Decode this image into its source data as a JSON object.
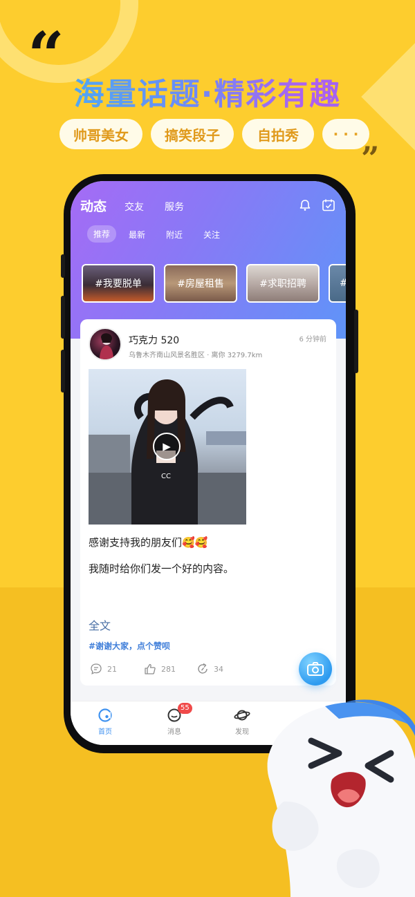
{
  "promo": {
    "headline": "海量话题·精彩有趣",
    "chips": [
      "帅哥美女",
      "搞笑段子",
      "自拍秀",
      "· · ·"
    ]
  },
  "app": {
    "nav_tabs": [
      "动态",
      "交友",
      "服务"
    ],
    "header_icons": [
      "bell-icon",
      "calendar-check-icon"
    ],
    "sub_tabs": [
      "推荐",
      "最新",
      "附近",
      "关注"
    ],
    "topics": [
      "#我要脱单",
      "#房屋租售",
      "#求职招聘",
      "#"
    ],
    "post": {
      "username": "巧克力 520",
      "location": "乌鲁木齐南山风景名胜区 · 离你 3279.7km",
      "time": "6 分钟前",
      "line1": "感谢支持我的朋友们🥰🥰",
      "line2": "我随时给你们发一个好的内容。",
      "more_label": "全文",
      "tag": "#谢谢大家，点个赞呗",
      "comments": "21",
      "likes": "281",
      "shares": "34"
    },
    "tabbar": {
      "home": "首页",
      "messages": "消息",
      "messages_badge": "55",
      "discover": "发现"
    },
    "colors": {
      "header_start": "#a56bf5",
      "header_end": "#5f94f8",
      "accent_blue": "#3f92f0",
      "background_yellow": "#fdcd2e"
    }
  }
}
